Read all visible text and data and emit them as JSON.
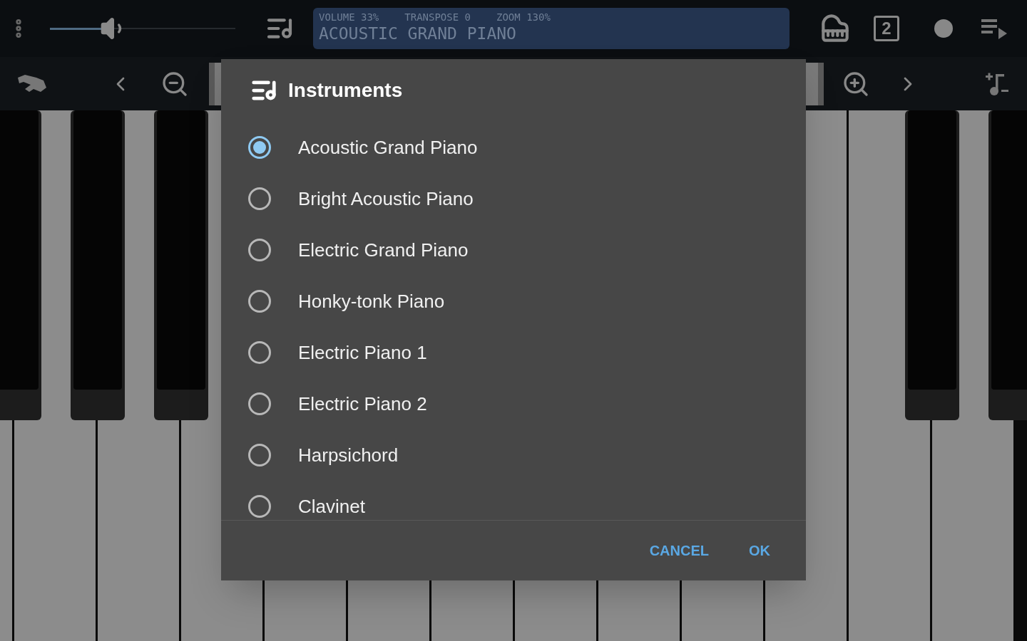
{
  "toolbar": {
    "volume": {
      "level": 0.3
    },
    "display": {
      "readings": [
        "VOLUME 33%",
        "TRANSPOSE 0",
        "ZOOM 130%"
      ],
      "instrument": "ACOUSTIC GRAND PIANO"
    },
    "track_number": "2"
  },
  "dialog": {
    "title": "Instruments",
    "options": [
      {
        "label": "Acoustic Grand Piano",
        "selected": true
      },
      {
        "label": "Bright Acoustic Piano",
        "selected": false
      },
      {
        "label": "Electric Grand Piano",
        "selected": false
      },
      {
        "label": "Honky-tonk Piano",
        "selected": false
      },
      {
        "label": "Electric Piano 1",
        "selected": false
      },
      {
        "label": "Electric Piano 2",
        "selected": false
      },
      {
        "label": "Harpsichord",
        "selected": false
      },
      {
        "label": "Clavinet",
        "selected": false
      }
    ],
    "buttons": [
      {
        "label": "CANCEL"
      },
      {
        "label": "OK"
      }
    ]
  }
}
